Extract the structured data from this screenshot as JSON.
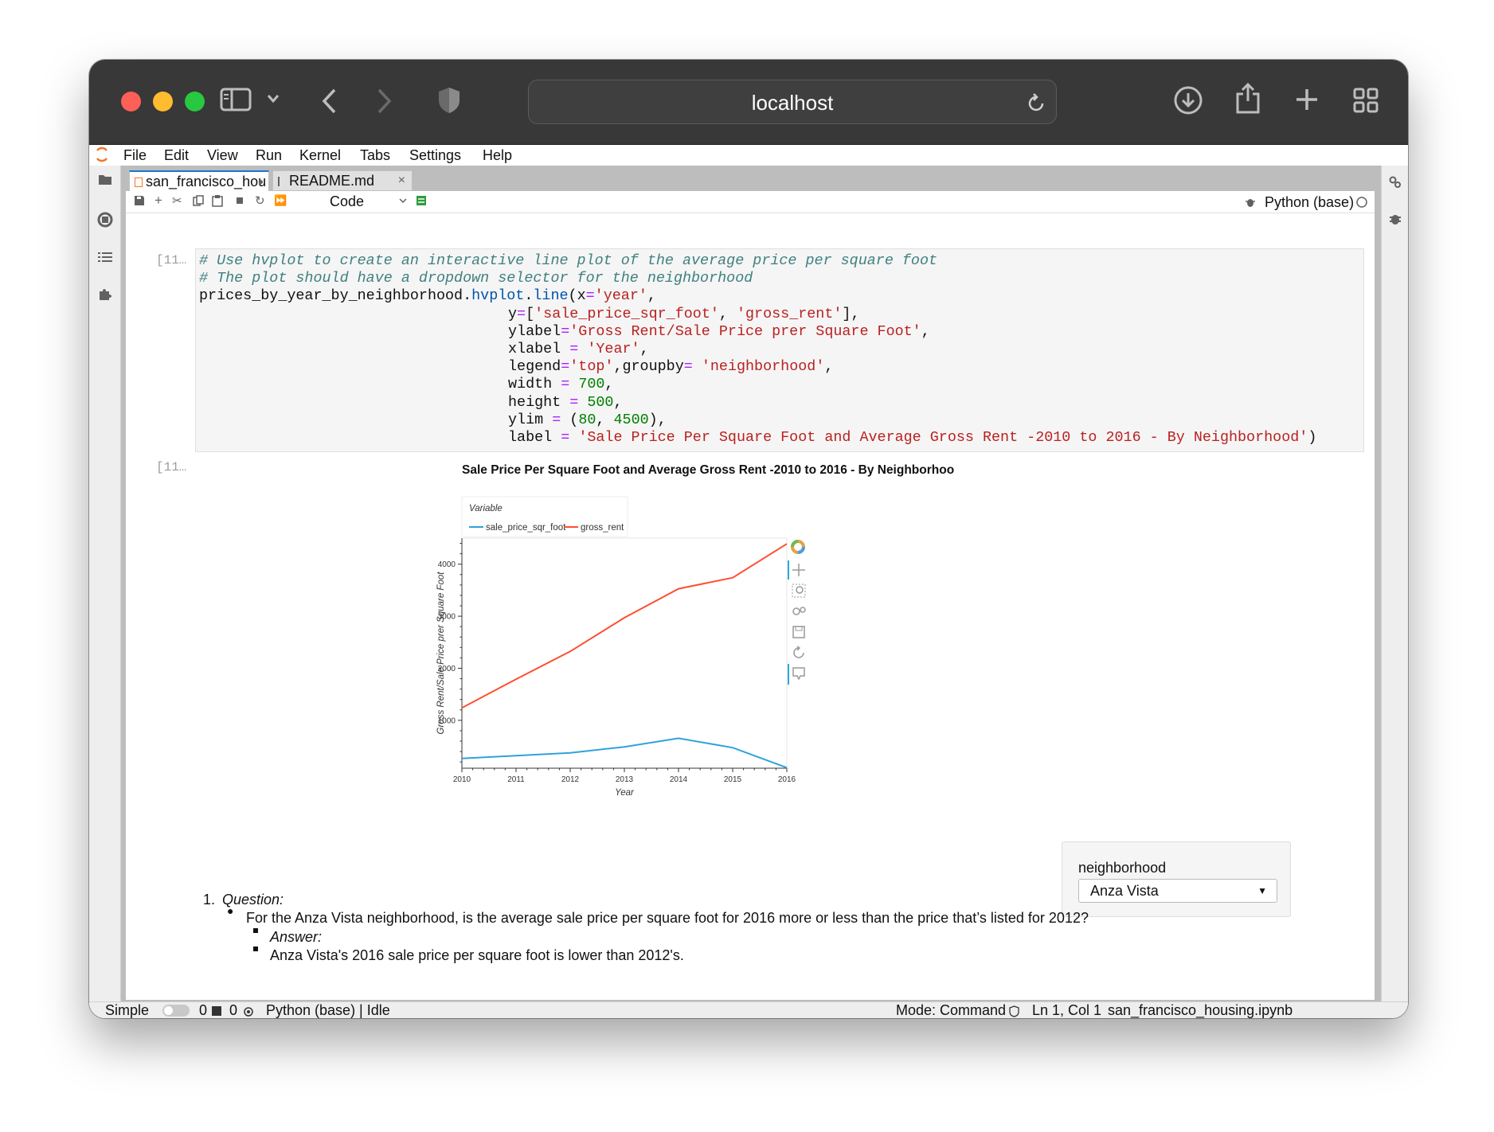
{
  "browser": {
    "address": "localhost"
  },
  "menu": [
    "File",
    "Edit",
    "View",
    "Run",
    "Kernel",
    "Tabs",
    "Settings",
    "Help"
  ],
  "tabs": [
    {
      "label": "san_francisco_hou",
      "dot": "●"
    },
    {
      "label": "README.md",
      "close": "×"
    }
  ],
  "toolbar": {
    "cell_type": "Code",
    "kernel": "Python (base)"
  },
  "cells": {
    "input_prompt": "[11…",
    "output_prompt": "[11…"
  },
  "code": {
    "line1": "# Use hvplot to create an interactive line plot of the average price per square foot",
    "line2": "# The plot should have a dropdown selector for the neighborhood",
    "line3_a": "prices_by_year_by_neighborhood.",
    "line3_b": "hvplot",
    "line3_c": ".",
    "line3_d": "line",
    "line3_e": "(x",
    "line3_f": "=",
    "line3_g": "'year'",
    "line3_h": ",",
    "y_key": "y",
    "y_list_a": "[",
    "y_list_b": "'sale_price_sqr_foot'",
    "y_list_c": ", ",
    "y_list_d": "'gross_rent'",
    "y_list_e": "],",
    "ylabel_key": "ylabel",
    "ylabel_val": "'Gross Rent/Sale Price prer Square Foot'",
    "xlabel_key": "xlabel ",
    "xlabel_val": "'Year'",
    "legend_key": "legend",
    "legend_val": "'top'",
    "groupby_key": ",groupby",
    "groupby_val": "'neighborhood'",
    "width_key": "width ",
    "width_val": "700",
    "height_key": "height ",
    "height_val": "500",
    "ylim_key": "ylim ",
    "ylim_a": "80",
    "ylim_b": "4500",
    "label_key": "label ",
    "label_val": "'Sale Price Per Square Foot and Average Gross Rent -2010 to 2016 - By Neighborhood'",
    "eq": "=",
    "comma": ",",
    "paren_open": "(",
    "paren_close": "),",
    "close": ")"
  },
  "chart_data": {
    "type": "line",
    "title": "Sale Price Per Square Foot and Average Gross Rent -2010 to 2016 - By Neighborhoo",
    "xlabel": "Year",
    "ylabel": "Gross Rent/Sale Price prer Square Foot",
    "legend_title": "Variable",
    "legend_placement": "top",
    "x": [
      2010,
      2011,
      2012,
      2013,
      2014,
      2015,
      2016
    ],
    "xticks": [
      "2010",
      "2011",
      "2012",
      "2013",
      "2014",
      "2015",
      "2016"
    ],
    "yticks": [
      1000,
      2000,
      3000,
      4000
    ],
    "ytick_labels": [
      "1000",
      "2000",
      "3000",
      "4000"
    ],
    "ylim": [
      80,
      4500
    ],
    "xlim": [
      2010,
      2016
    ],
    "grid": false,
    "series": [
      {
        "name": "sale_price_sqr_foot",
        "color": "#30a2da",
        "values": [
          268,
          320,
          375,
          490,
          655,
          475,
          90
        ]
      },
      {
        "name": "gross_rent",
        "color": "#fc4f30",
        "values": [
          1239,
          1790,
          2324,
          2971,
          3528,
          3740,
          4390
        ]
      }
    ]
  },
  "widget": {
    "label": "neighborhood",
    "value": "Anza Vista",
    "arrow": "▼"
  },
  "markdown": {
    "num": "1.",
    "question": "Question:",
    "bullet1": "For the Anza Vista neighborhood, is the average sale price per square foot for 2016 more or less than the price that’s listed for 2012?",
    "answer": "Answer:",
    "bullet2": "Anza Vista's 2016 sale price per square foot is lower than 2012's."
  },
  "status": {
    "simple": "Simple",
    "n1": "0",
    "n2": "0",
    "kernel": "Python (base) | Idle",
    "mode": "Mode: Command",
    "position": "Ln 1, Col 1",
    "file": "san_francisco_housing.ipynb"
  }
}
